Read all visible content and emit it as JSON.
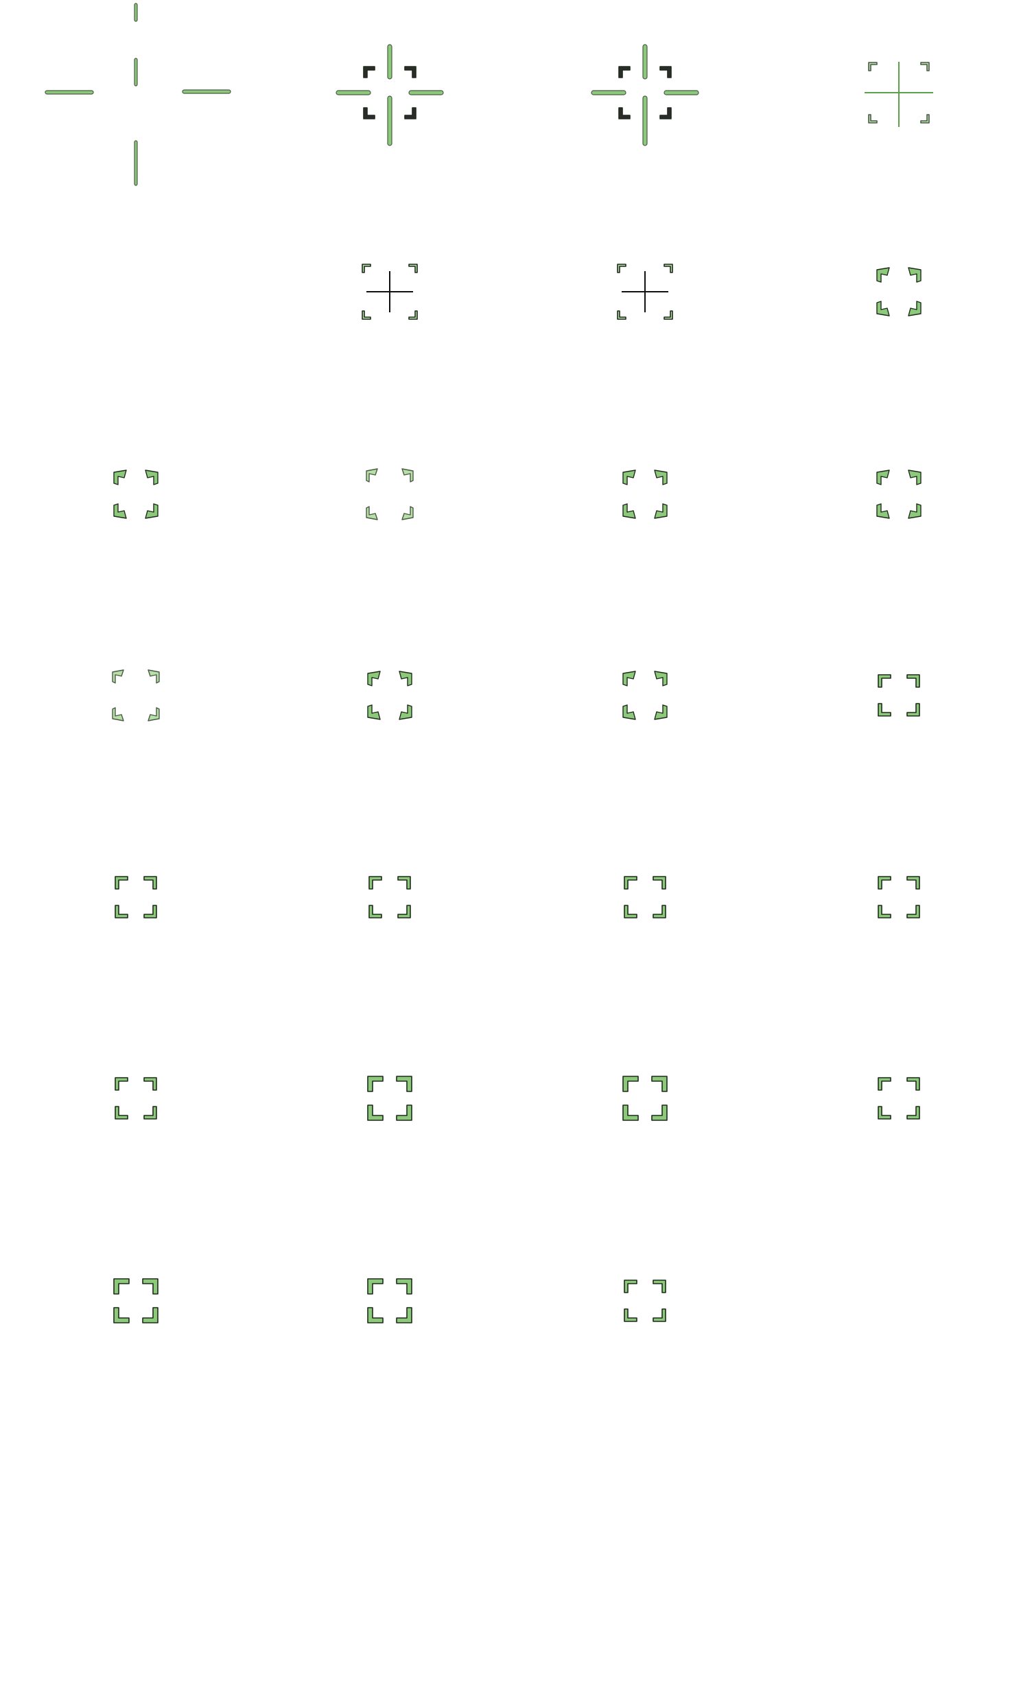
{
  "sheet": {
    "description_visible_text": "",
    "columns": 4,
    "rows": 7,
    "colors": {
      "background": "#ffffff",
      "fill_light": "#b7dfa7",
      "fill_mid": "#8cc97a",
      "fill_dark": "#5aa34a",
      "outline": "#1d2a1a",
      "outline_soft": "#4a5a46"
    },
    "frames": [
      {
        "icon": "crosshair-icon",
        "style": "crosshair-wide",
        "corners": false,
        "cross": true
      },
      {
        "icon": "crosshair-bracket-icon",
        "style": "crosshair-bracket-dark",
        "corners": true,
        "cross": true
      },
      {
        "icon": "crosshair-bracket-icon",
        "style": "crosshair-bracket-dark",
        "corners": true,
        "cross": true
      },
      {
        "icon": "crosshair-bracket-icon",
        "style": "crosshair-bracket-thin",
        "corners": true,
        "cross": true
      },
      {
        "icon": "empty-frame",
        "style": "empty",
        "corners": false,
        "cross": false
      },
      {
        "icon": "crosshair-bracket-icon",
        "style": "crosshair-bracket-small",
        "corners": true,
        "cross": true
      },
      {
        "icon": "crosshair-bracket-icon",
        "style": "crosshair-bracket-small",
        "corners": true,
        "cross": true
      },
      {
        "icon": "corner-brackets-icon",
        "style": "arrow-corners",
        "corners": true,
        "cross": false
      },
      {
        "icon": "corner-brackets-icon",
        "style": "arrow-corners",
        "corners": true,
        "cross": false
      },
      {
        "icon": "corner-brackets-icon",
        "style": "arrow-corners-thin",
        "corners": true,
        "cross": false
      },
      {
        "icon": "corner-brackets-icon",
        "style": "arrow-corners",
        "corners": true,
        "cross": false
      },
      {
        "icon": "corner-brackets-icon",
        "style": "arrow-corners",
        "corners": true,
        "cross": false
      },
      {
        "icon": "corner-brackets-icon",
        "style": "arrow-corners-thin",
        "corners": true,
        "cross": false
      },
      {
        "icon": "corner-brackets-icon",
        "style": "arrow-corners",
        "corners": true,
        "cross": false
      },
      {
        "icon": "corner-brackets-icon",
        "style": "arrow-corners",
        "corners": true,
        "cross": false
      },
      {
        "icon": "corner-brackets-icon",
        "style": "brackets",
        "corners": true,
        "cross": false
      },
      {
        "icon": "corner-brackets-icon",
        "style": "brackets",
        "corners": true,
        "cross": false
      },
      {
        "icon": "corner-brackets-icon",
        "style": "brackets",
        "corners": true,
        "cross": false
      },
      {
        "icon": "corner-brackets-icon",
        "style": "brackets",
        "corners": true,
        "cross": false
      },
      {
        "icon": "corner-brackets-icon",
        "style": "brackets",
        "corners": true,
        "cross": false
      },
      {
        "icon": "corner-brackets-icon",
        "style": "brackets",
        "corners": true,
        "cross": false
      },
      {
        "icon": "corner-brackets-icon",
        "style": "brackets-bold",
        "corners": true,
        "cross": false
      },
      {
        "icon": "corner-brackets-icon",
        "style": "brackets-bold",
        "corners": true,
        "cross": false
      },
      {
        "icon": "corner-brackets-icon",
        "style": "brackets",
        "corners": true,
        "cross": false
      },
      {
        "icon": "corner-brackets-icon",
        "style": "brackets-bold",
        "corners": true,
        "cross": false
      },
      {
        "icon": "corner-brackets-icon",
        "style": "brackets-bold",
        "corners": true,
        "cross": false
      },
      {
        "icon": "corner-brackets-icon",
        "style": "brackets",
        "corners": true,
        "cross": false
      },
      {
        "icon": "empty-frame",
        "style": "empty",
        "corners": false,
        "cross": false
      }
    ]
  }
}
